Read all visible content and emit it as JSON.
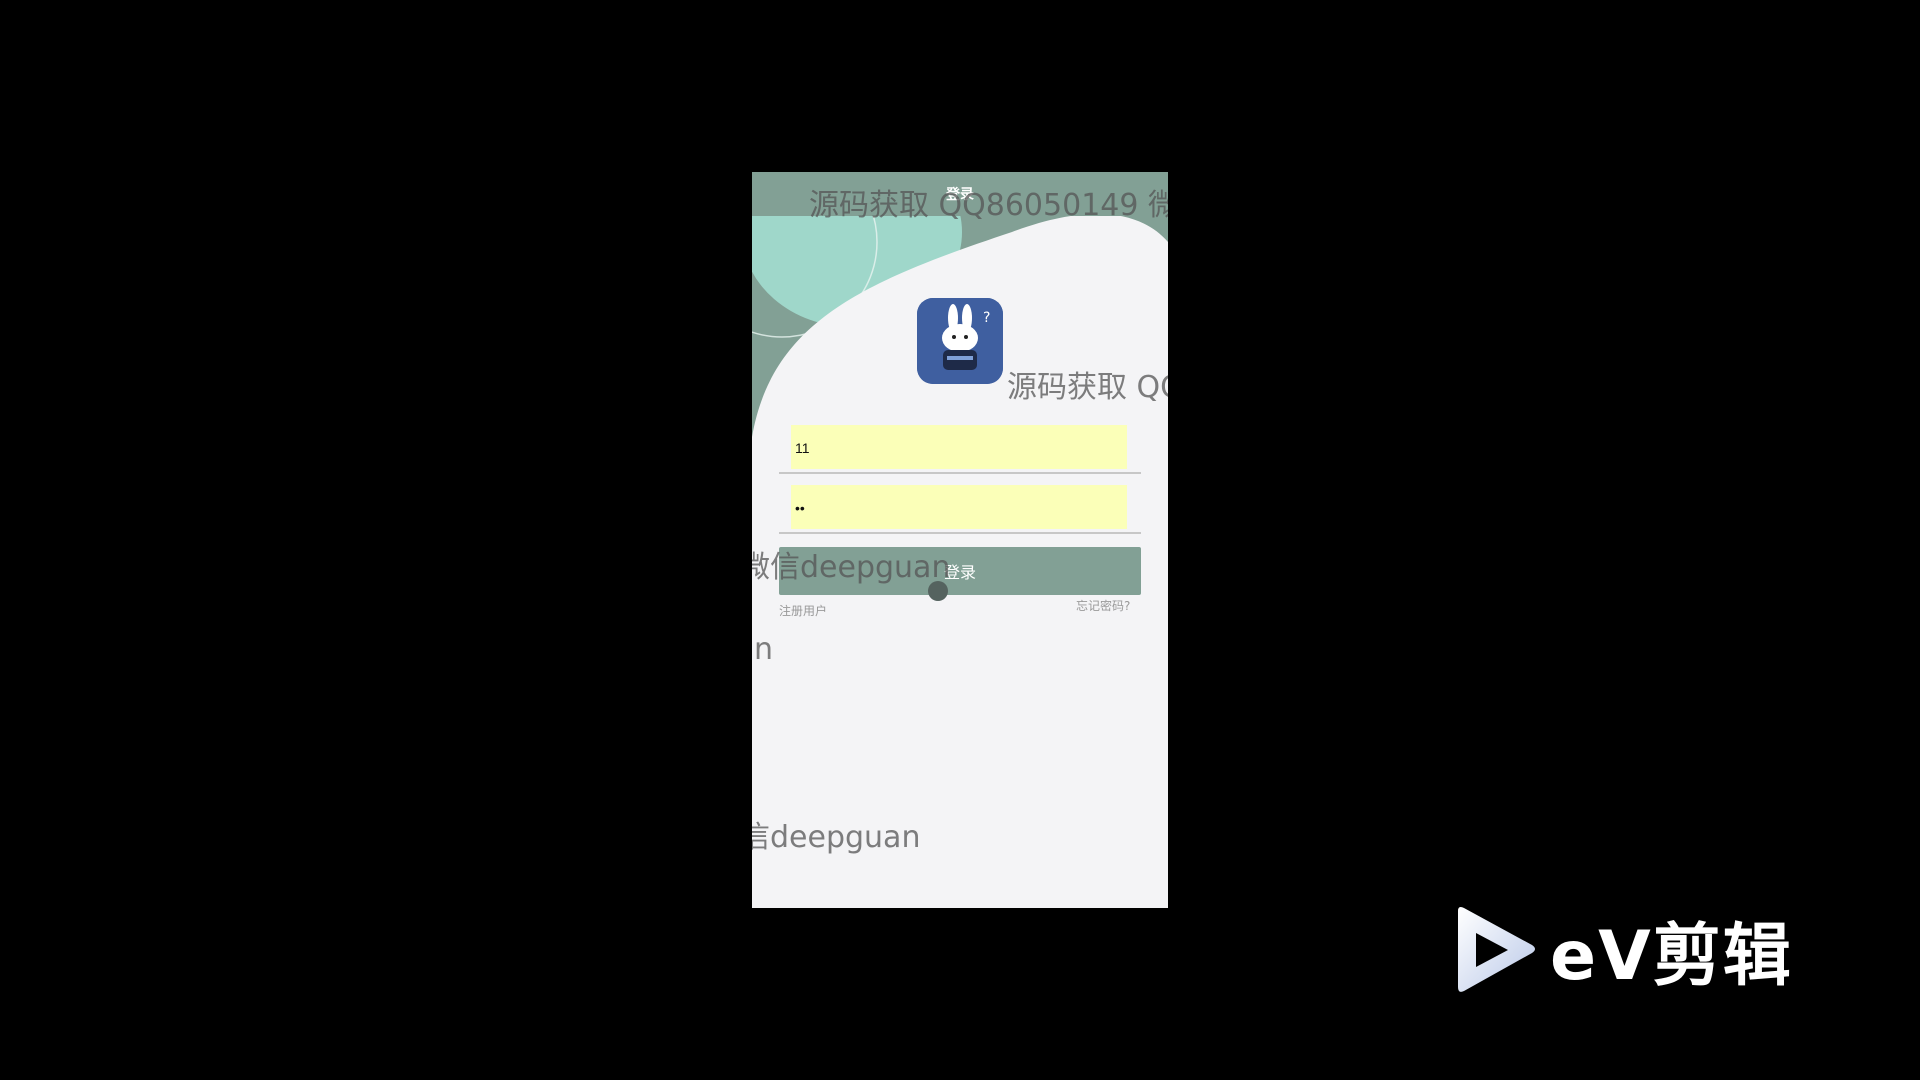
{
  "app": {
    "title": "登录",
    "username_value": "11",
    "password_value": "11",
    "login_label": "登录",
    "register_label": "注册用户",
    "forgot_label": "忘记密码?"
  },
  "watermarks": [
    "源码获取 QQ86050149 微",
    "源码获取 QQ",
    "微信deepguan",
    "n",
    "信deepguan"
  ],
  "brand": {
    "name": "eV剪辑"
  },
  "colors": {
    "background": "#000000",
    "accent": "#82a095",
    "input_fill": "#fbffb8",
    "screen": "#f4f4f6"
  }
}
